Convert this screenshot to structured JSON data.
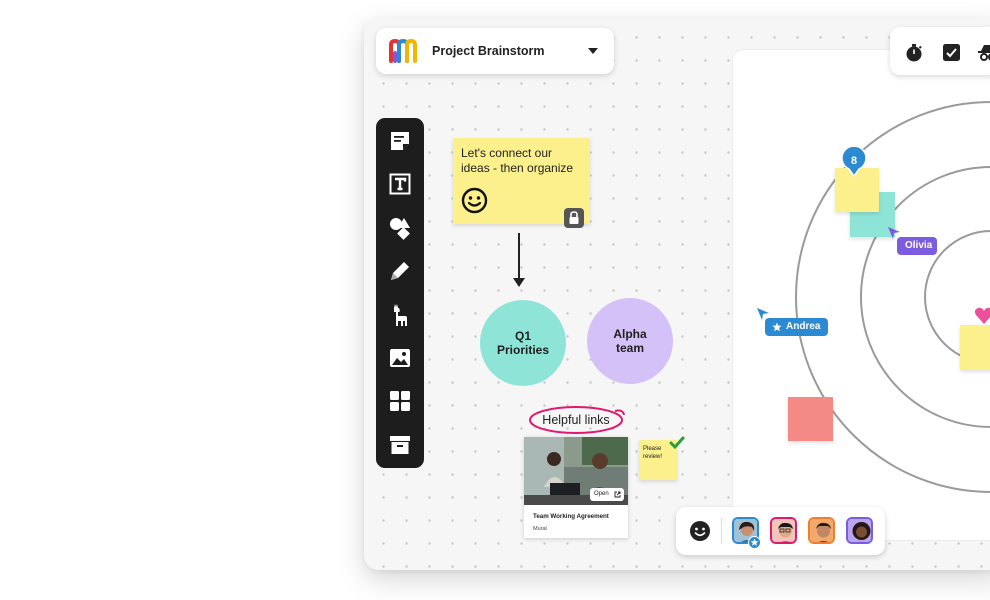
{
  "project": {
    "title": "Project Brainstorm"
  },
  "sticky_note": {
    "line1": "Let's connect our",
    "line2": "ideas - then organize"
  },
  "circles": [
    {
      "line1": "Q1",
      "line2": "Priorities"
    },
    {
      "line1": "Alpha",
      "line2": "team"
    }
  ],
  "helpful_links": "Helpful links",
  "link_card": {
    "open_label": "Open",
    "title": "Team Working Agreement",
    "source": "Mural"
  },
  "review_note": {
    "line1": "Please",
    "line2": "review!"
  },
  "vote_pin": {
    "count": "8"
  },
  "collaborators": {
    "olivia": "Olivia",
    "andrea": "Andrea"
  },
  "icons": [
    "mural-logo-icon",
    "chevron-down-icon",
    "timer-icon",
    "checkbox-icon",
    "incognito-icon",
    "sticky-note-icon",
    "text-icon",
    "shapes-icon",
    "pen-icon",
    "llama-icon",
    "image-icon",
    "templates-icon",
    "archive-icon",
    "smiley-icon",
    "lock-icon",
    "external-link-icon",
    "star-icon",
    "check-icon"
  ],
  "colors": {
    "sticky_yellow": "#fbf08c",
    "teal": "#8fe4d8",
    "lavender": "#d4c1f8",
    "olivia": "#7b5cde",
    "andrea": "#2b8ad2",
    "pink": "#e0196f",
    "red_square": "#f48a86"
  }
}
